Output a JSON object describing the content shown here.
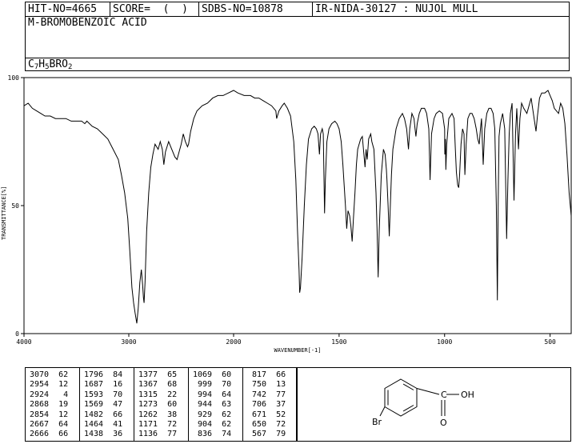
{
  "header": {
    "hit_no": "HIT-NO=4665",
    "score": "SCORE=  (  )",
    "sdbs_no": "SDBS-NO=10878",
    "ir_nida": "IR-NIDA-30127 : NUJOL MULL",
    "compound_name": "M-BROMOBENZOIC ACID",
    "formula_parts": [
      {
        "t": "C",
        "sub": false
      },
      {
        "t": "7",
        "sub": true
      },
      {
        "t": "H",
        "sub": false
      },
      {
        "t": "5",
        "sub": true
      },
      {
        "t": "BRO",
        "sub": false
      },
      {
        "t": "2",
        "sub": true
      }
    ]
  },
  "chart_data": {
    "type": "line",
    "xlabel": "WAVENUMBER[-1]",
    "ylabel": "TRANSMITTANCE[%]",
    "xlim": [
      4000,
      400
    ],
    "ylim": [
      0,
      100
    ],
    "x_ticks": [
      4000,
      3000,
      2000,
      1500,
      1000,
      500
    ],
    "y_ticks": [
      0,
      50,
      100
    ],
    "series": [
      {
        "points": [
          [
            4000,
            89
          ],
          [
            3960,
            90
          ],
          [
            3920,
            88
          ],
          [
            3880,
            87
          ],
          [
            3840,
            86
          ],
          [
            3800,
            85
          ],
          [
            3750,
            85
          ],
          [
            3700,
            84
          ],
          [
            3650,
            84
          ],
          [
            3600,
            84
          ],
          [
            3550,
            83
          ],
          [
            3500,
            83
          ],
          [
            3450,
            83
          ],
          [
            3420,
            82
          ],
          [
            3400,
            83
          ],
          [
            3350,
            81
          ],
          [
            3300,
            80
          ],
          [
            3250,
            78
          ],
          [
            3200,
            76
          ],
          [
            3150,
            72
          ],
          [
            3100,
            68
          ],
          [
            3070,
            62
          ],
          [
            3040,
            55
          ],
          [
            3010,
            45
          ],
          [
            2990,
            32
          ],
          [
            2970,
            18
          ],
          [
            2954,
            12
          ],
          [
            2940,
            8
          ],
          [
            2924,
            4
          ],
          [
            2910,
            10
          ],
          [
            2895,
            20
          ],
          [
            2880,
            25
          ],
          [
            2868,
            19
          ],
          [
            2860,
            14
          ],
          [
            2854,
            12
          ],
          [
            2845,
            20
          ],
          [
            2830,
            40
          ],
          [
            2810,
            55
          ],
          [
            2790,
            65
          ],
          [
            2770,
            70
          ],
          [
            2750,
            74
          ],
          [
            2720,
            72
          ],
          [
            2700,
            75
          ],
          [
            2680,
            72
          ],
          [
            2666,
            66
          ],
          [
            2650,
            71
          ],
          [
            2620,
            75
          ],
          [
            2600,
            73
          ],
          [
            2580,
            71
          ],
          [
            2560,
            69
          ],
          [
            2540,
            68
          ],
          [
            2520,
            71
          ],
          [
            2500,
            74
          ],
          [
            2480,
            78
          ],
          [
            2460,
            75
          ],
          [
            2440,
            73
          ],
          [
            2430,
            74
          ],
          [
            2410,
            79
          ],
          [
            2380,
            84
          ],
          [
            2350,
            87
          ],
          [
            2300,
            89
          ],
          [
            2250,
            90
          ],
          [
            2200,
            92
          ],
          [
            2150,
            93
          ],
          [
            2100,
            93
          ],
          [
            2050,
            94
          ],
          [
            2000,
            95
          ],
          [
            1980,
            94
          ],
          [
            1950,
            93
          ],
          [
            1920,
            93
          ],
          [
            1900,
            92
          ],
          [
            1880,
            92
          ],
          [
            1860,
            91
          ],
          [
            1840,
            90
          ],
          [
            1820,
            89
          ],
          [
            1800,
            87
          ],
          [
            1796,
            84
          ],
          [
            1785,
            87
          ],
          [
            1770,
            89
          ],
          [
            1760,
            90
          ],
          [
            1745,
            88
          ],
          [
            1730,
            85
          ],
          [
            1715,
            75
          ],
          [
            1705,
            60
          ],
          [
            1697,
            40
          ],
          [
            1690,
            25
          ],
          [
            1687,
            16
          ],
          [
            1683,
            18
          ],
          [
            1675,
            30
          ],
          [
            1665,
            50
          ],
          [
            1655,
            66
          ],
          [
            1645,
            76
          ],
          [
            1630,
            80
          ],
          [
            1618,
            81
          ],
          [
            1608,
            80
          ],
          [
            1600,
            78
          ],
          [
            1593,
            70
          ],
          [
            1588,
            78
          ],
          [
            1580,
            80
          ],
          [
            1575,
            78
          ],
          [
            1569,
            47
          ],
          [
            1565,
            60
          ],
          [
            1558,
            75
          ],
          [
            1548,
            80
          ],
          [
            1535,
            82
          ],
          [
            1520,
            83
          ],
          [
            1510,
            82
          ],
          [
            1500,
            80
          ],
          [
            1490,
            75
          ],
          [
            1482,
            66
          ],
          [
            1476,
            58
          ],
          [
            1470,
            50
          ],
          [
            1464,
            41
          ],
          [
            1458,
            48
          ],
          [
            1450,
            46
          ],
          [
            1444,
            42
          ],
          [
            1438,
            36
          ],
          [
            1432,
            45
          ],
          [
            1425,
            55
          ],
          [
            1418,
            66
          ],
          [
            1412,
            72
          ],
          [
            1405,
            74
          ],
          [
            1398,
            76
          ],
          [
            1390,
            77
          ],
          [
            1377,
            65
          ],
          [
            1372,
            72
          ],
          [
            1367,
            68
          ],
          [
            1360,
            76
          ],
          [
            1350,
            78
          ],
          [
            1345,
            75
          ],
          [
            1335,
            72
          ],
          [
            1325,
            55
          ],
          [
            1320,
            40
          ],
          [
            1315,
            22
          ],
          [
            1310,
            40
          ],
          [
            1300,
            62
          ],
          [
            1290,
            72
          ],
          [
            1282,
            70
          ],
          [
            1276,
            64
          ],
          [
            1273,
            60
          ],
          [
            1268,
            50
          ],
          [
            1264,
            42
          ],
          [
            1262,
            38
          ],
          [
            1258,
            48
          ],
          [
            1252,
            62
          ],
          [
            1245,
            72
          ],
          [
            1230,
            80
          ],
          [
            1215,
            84
          ],
          [
            1200,
            86
          ],
          [
            1190,
            84
          ],
          [
            1180,
            80
          ],
          [
            1171,
            72
          ],
          [
            1165,
            80
          ],
          [
            1155,
            86
          ],
          [
            1145,
            84
          ],
          [
            1140,
            80
          ],
          [
            1136,
            77
          ],
          [
            1130,
            82
          ],
          [
            1120,
            86
          ],
          [
            1110,
            88
          ],
          [
            1095,
            88
          ],
          [
            1085,
            86
          ],
          [
            1075,
            80
          ],
          [
            1069,
            60
          ],
          [
            1062,
            78
          ],
          [
            1050,
            84
          ],
          [
            1040,
            86
          ],
          [
            1025,
            87
          ],
          [
            1010,
            86
          ],
          [
            1000,
            80
          ],
          [
            999,
            70
          ],
          [
            996,
            76
          ],
          [
            994,
            64
          ],
          [
            990,
            74
          ],
          [
            980,
            84
          ],
          [
            965,
            86
          ],
          [
            955,
            84
          ],
          [
            949,
            72
          ],
          [
            944,
            63
          ],
          [
            938,
            58
          ],
          [
            933,
            57
          ],
          [
            929,
            62
          ],
          [
            922,
            74
          ],
          [
            915,
            80
          ],
          [
            908,
            78
          ],
          [
            904,
            62
          ],
          [
            898,
            74
          ],
          [
            890,
            84
          ],
          [
            880,
            86
          ],
          [
            870,
            86
          ],
          [
            860,
            84
          ],
          [
            850,
            80
          ],
          [
            843,
            76
          ],
          [
            836,
            74
          ],
          [
            830,
            80
          ],
          [
            825,
            84
          ],
          [
            817,
            66
          ],
          [
            810,
            80
          ],
          [
            800,
            86
          ],
          [
            790,
            88
          ],
          [
            780,
            88
          ],
          [
            770,
            86
          ],
          [
            762,
            80
          ],
          [
            755,
            50
          ],
          [
            750,
            13
          ],
          [
            746,
            50
          ],
          [
            742,
            77
          ],
          [
            736,
            82
          ],
          [
            725,
            86
          ],
          [
            715,
            80
          ],
          [
            706,
            37
          ],
          [
            700,
            60
          ],
          [
            694,
            78
          ],
          [
            688,
            86
          ],
          [
            680,
            90
          ],
          [
            671,
            52
          ],
          [
            664,
            78
          ],
          [
            658,
            88
          ],
          [
            650,
            72
          ],
          [
            643,
            84
          ],
          [
            635,
            90
          ],
          [
            625,
            88
          ],
          [
            610,
            86
          ],
          [
            590,
            92
          ],
          [
            567,
            79
          ],
          [
            560,
            85
          ],
          [
            550,
            92
          ],
          [
            540,
            94
          ],
          [
            525,
            94
          ],
          [
            510,
            95
          ],
          [
            500,
            93
          ],
          [
            490,
            91
          ],
          [
            480,
            88
          ],
          [
            470,
            87
          ],
          [
            460,
            86
          ],
          [
            450,
            90
          ],
          [
            440,
            88
          ],
          [
            430,
            82
          ],
          [
            420,
            70
          ],
          [
            410,
            55
          ],
          [
            400,
            46
          ]
        ]
      }
    ]
  },
  "peaks": {
    "columns": [
      [
        [
          "3070",
          "62"
        ],
        [
          "2954",
          "12"
        ],
        [
          "2924",
          "4"
        ],
        [
          "2868",
          "19"
        ],
        [
          "2854",
          "12"
        ],
        [
          "2667",
          "64"
        ],
        [
          "2666",
          "66"
        ]
      ],
      [
        [
          "1796",
          "84"
        ],
        [
          "1687",
          "16"
        ],
        [
          "1593",
          "70"
        ],
        [
          "1569",
          "47"
        ],
        [
          "1482",
          "66"
        ],
        [
          "1464",
          "41"
        ],
        [
          "1438",
          "36"
        ]
      ],
      [
        [
          "1377",
          "65"
        ],
        [
          "1367",
          "68"
        ],
        [
          "1315",
          "22"
        ],
        [
          "1273",
          "60"
        ],
        [
          "1262",
          "38"
        ],
        [
          "1171",
          "72"
        ],
        [
          "1136",
          "77"
        ]
      ],
      [
        [
          "1069",
          "60"
        ],
        [
          "999",
          "70"
        ],
        [
          "994",
          "64"
        ],
        [
          "944",
          "63"
        ],
        [
          "929",
          "62"
        ],
        [
          "904",
          "62"
        ],
        [
          "836",
          "74"
        ]
      ],
      [
        [
          "817",
          "66"
        ],
        [
          "750",
          "13"
        ],
        [
          "742",
          "77"
        ],
        [
          "706",
          "37"
        ],
        [
          "671",
          "52"
        ],
        [
          "650",
          "72"
        ],
        [
          "567",
          "79"
        ]
      ]
    ]
  },
  "structure": {
    "cooh_label": "C",
    "oh_label": "OH",
    "o_label": "O",
    "br_label": "Br"
  }
}
